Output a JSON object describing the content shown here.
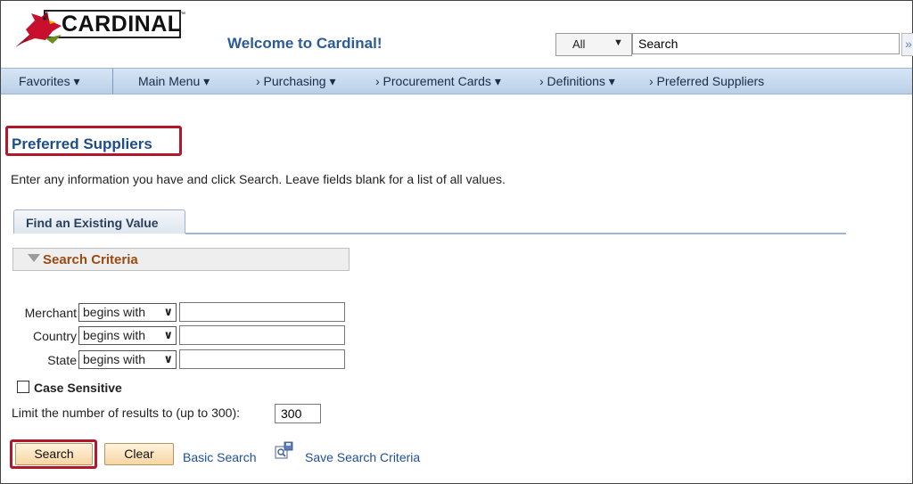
{
  "header": {
    "logo_text": "CARDINAL",
    "logo_tm": "™",
    "welcome": "Welcome to Cardinal!",
    "search_scope": "All",
    "search_value": "Search",
    "go_icon": "»"
  },
  "nav": {
    "favorites": "Favorites ▾",
    "main_menu": "Main Menu ▾",
    "crumbs": [
      "›  Purchasing ▾",
      "›  Procurement Cards ▾",
      "›  Definitions ▾",
      "›  Preferred Suppliers"
    ]
  },
  "page": {
    "title": "Preferred Suppliers",
    "instructions": "Enter any information you have and click Search. Leave fields blank for a list of all values.",
    "tab": "Find an Existing Value",
    "criteria_header": "Search Criteria",
    "fields": [
      {
        "label": "Merchant",
        "operator": "begins with",
        "value": ""
      },
      {
        "label": "Country",
        "operator": "begins with",
        "value": ""
      },
      {
        "label": "State",
        "operator": "begins with",
        "value": ""
      }
    ],
    "case_sensitive": "Case Sensitive",
    "limit_label": "Limit the number of results to (up to 300):",
    "limit_value": "300"
  },
  "buttons": {
    "search": "Search",
    "clear": "Clear",
    "basic_search": "Basic Search",
    "save_criteria": "Save Search Criteria"
  },
  "colors": {
    "highlight": "#b0182b",
    "title": "#1e4d8c",
    "criteria": "#9b4a12",
    "link": "#1f4f9a"
  }
}
